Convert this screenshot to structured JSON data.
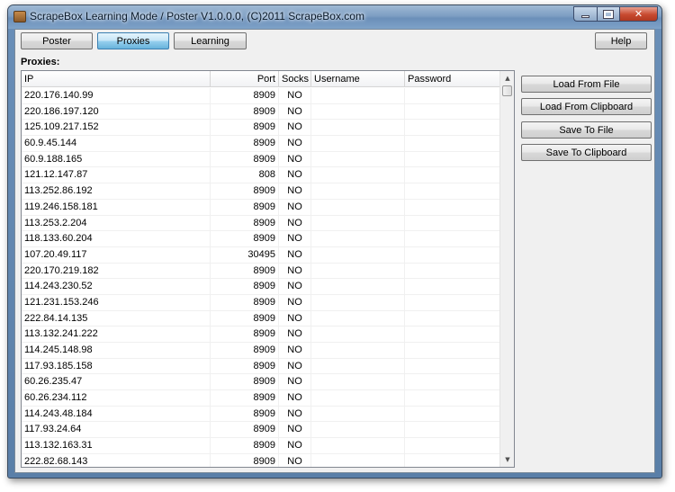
{
  "window": {
    "title": "ScrapeBox Learning Mode / Poster V1.0.0.0, (C)2011 ScrapeBox.com"
  },
  "tabs": [
    {
      "label": "Poster",
      "active": false
    },
    {
      "label": "Proxies",
      "active": true
    },
    {
      "label": "Learning",
      "active": false
    }
  ],
  "help_label": "Help",
  "section_label": "Proxies:",
  "table": {
    "columns": [
      "IP",
      "Port",
      "Socks",
      "Username",
      "Password"
    ],
    "rows": [
      {
        "ip": "220.176.140.99",
        "port": "8909",
        "socks": "NO",
        "username": "",
        "password": ""
      },
      {
        "ip": "220.186.197.120",
        "port": "8909",
        "socks": "NO",
        "username": "",
        "password": ""
      },
      {
        "ip": "125.109.217.152",
        "port": "8909",
        "socks": "NO",
        "username": "",
        "password": ""
      },
      {
        "ip": "60.9.45.144",
        "port": "8909",
        "socks": "NO",
        "username": "",
        "password": ""
      },
      {
        "ip": "60.9.188.165",
        "port": "8909",
        "socks": "NO",
        "username": "",
        "password": ""
      },
      {
        "ip": "121.12.147.87",
        "port": "808",
        "socks": "NO",
        "username": "",
        "password": ""
      },
      {
        "ip": "113.252.86.192",
        "port": "8909",
        "socks": "NO",
        "username": "",
        "password": ""
      },
      {
        "ip": "119.246.158.181",
        "port": "8909",
        "socks": "NO",
        "username": "",
        "password": ""
      },
      {
        "ip": "113.253.2.204",
        "port": "8909",
        "socks": "NO",
        "username": "",
        "password": ""
      },
      {
        "ip": "118.133.60.204",
        "port": "8909",
        "socks": "NO",
        "username": "",
        "password": ""
      },
      {
        "ip": "107.20.49.117",
        "port": "30495",
        "socks": "NO",
        "username": "",
        "password": ""
      },
      {
        "ip": "220.170.219.182",
        "port": "8909",
        "socks": "NO",
        "username": "",
        "password": ""
      },
      {
        "ip": "114.243.230.52",
        "port": "8909",
        "socks": "NO",
        "username": "",
        "password": ""
      },
      {
        "ip": "121.231.153.246",
        "port": "8909",
        "socks": "NO",
        "username": "",
        "password": ""
      },
      {
        "ip": "222.84.14.135",
        "port": "8909",
        "socks": "NO",
        "username": "",
        "password": ""
      },
      {
        "ip": "113.132.241.222",
        "port": "8909",
        "socks": "NO",
        "username": "",
        "password": ""
      },
      {
        "ip": "114.245.148.98",
        "port": "8909",
        "socks": "NO",
        "username": "",
        "password": ""
      },
      {
        "ip": "117.93.185.158",
        "port": "8909",
        "socks": "NO",
        "username": "",
        "password": ""
      },
      {
        "ip": "60.26.235.47",
        "port": "8909",
        "socks": "NO",
        "username": "",
        "password": ""
      },
      {
        "ip": "60.26.234.112",
        "port": "8909",
        "socks": "NO",
        "username": "",
        "password": ""
      },
      {
        "ip": "114.243.48.184",
        "port": "8909",
        "socks": "NO",
        "username": "",
        "password": ""
      },
      {
        "ip": "117.93.24.64",
        "port": "8909",
        "socks": "NO",
        "username": "",
        "password": ""
      },
      {
        "ip": "113.132.163.31",
        "port": "8909",
        "socks": "NO",
        "username": "",
        "password": ""
      },
      {
        "ip": "222.82.68.143",
        "port": "8909",
        "socks": "NO",
        "username": "",
        "password": ""
      }
    ]
  },
  "side_buttons": [
    {
      "label": "Load From File"
    },
    {
      "label": "Load From Clipboard"
    },
    {
      "label": "Save To File"
    },
    {
      "label": "Save To Clipboard"
    }
  ],
  "icons": {
    "app": "scrapebox-app-icon",
    "minimize": "minimize-icon",
    "maximize": "maximize-icon",
    "close": "close-icon",
    "scroll_up": "scroll-up-arrow-icon",
    "scroll_down": "scroll-down-arrow-icon"
  }
}
